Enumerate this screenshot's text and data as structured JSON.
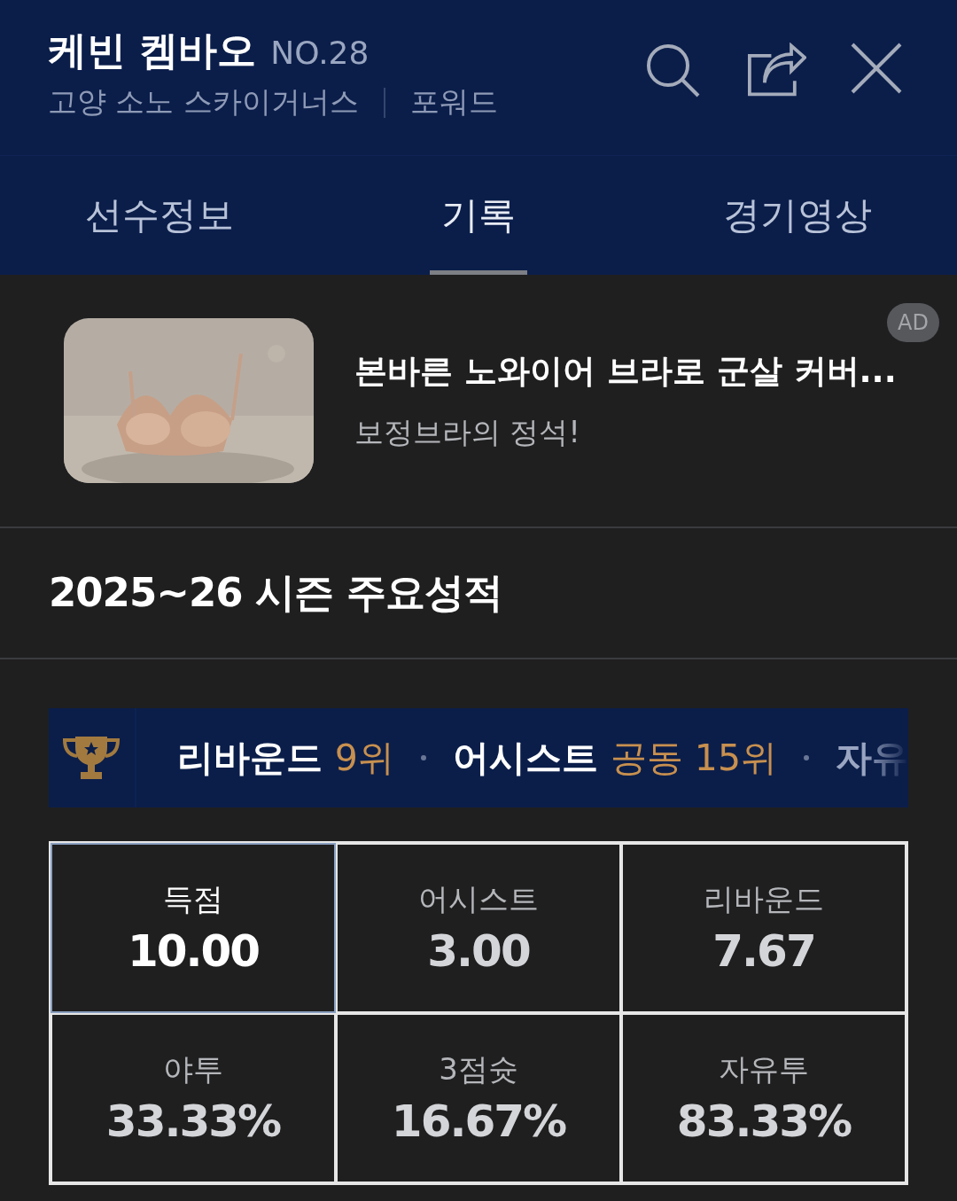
{
  "header": {
    "name": "케빈 켐바오",
    "number": "NO.28",
    "team": "고양 소노 스카이거너스",
    "position": "포워드"
  },
  "tabs": [
    {
      "label": "선수정보",
      "selected": false
    },
    {
      "label": "기록",
      "selected": true
    },
    {
      "label": "경기영상",
      "selected": false
    }
  ],
  "ad": {
    "badge": "AD",
    "title": "본바른 노와이어 브라로 군살 커버...",
    "subtitle": "보정브라의 정석!"
  },
  "section_title": "2025~26 시즌 주요성적",
  "rankings": [
    {
      "label": "리바운드",
      "rank": "9위",
      "faded": false
    },
    {
      "label": "어시스트",
      "rank": "공동 15위",
      "faded": false
    },
    {
      "label": "자유",
      "faded": true
    }
  ],
  "stats": [
    {
      "label": "득점",
      "value": "10.00",
      "selected": true
    },
    {
      "label": "어시스트",
      "value": "3.00",
      "selected": false
    },
    {
      "label": "리바운드",
      "value": "7.67",
      "selected": false
    },
    {
      "label": "야투",
      "value": "33.33%",
      "selected": false
    },
    {
      "label": "3점슛",
      "value": "16.67%",
      "selected": false
    },
    {
      "label": "자유투",
      "value": "83.33%",
      "selected": false
    }
  ]
}
